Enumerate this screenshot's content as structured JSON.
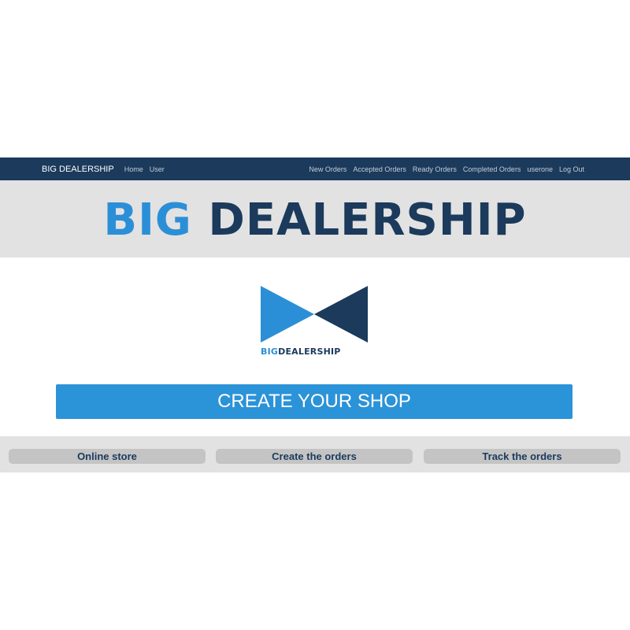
{
  "navbar": {
    "brand": "BIG DEALERSHIP",
    "left_links": [
      "Home",
      "User"
    ],
    "right_links": [
      "New Orders",
      "Accepted Orders",
      "Ready Orders",
      "Completed Orders",
      "userone",
      "Log Out"
    ]
  },
  "hero": {
    "title_part1": "BIG",
    "title_part2": "DEALERSHIP"
  },
  "logo": {
    "text_part1": "BIG",
    "text_part2": "DEALERSHIP"
  },
  "cta": {
    "label": "CREATE YOUR SHOP"
  },
  "features": [
    "Online store",
    "Create the orders",
    "Track the orders"
  ],
  "colors": {
    "navy": "#1b3a5c",
    "blue": "#2b8fd7",
    "panel_gray": "#e2e2e2",
    "feature_gray": "#c4c4c4"
  },
  "icons": {
    "logo_mark": "bowtie-triangles-icon"
  }
}
